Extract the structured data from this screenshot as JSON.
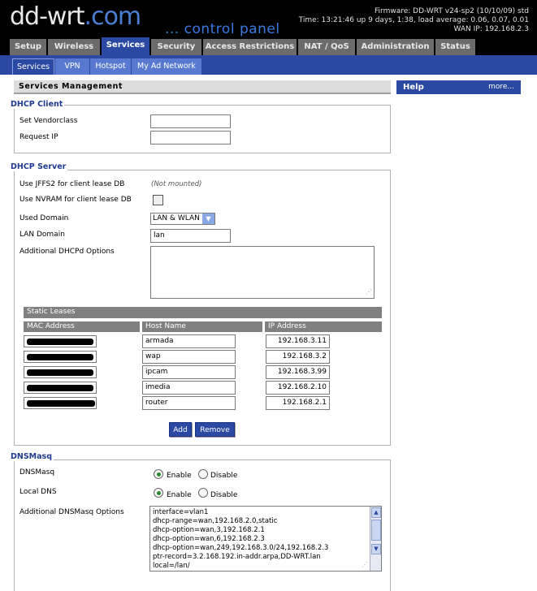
{
  "header": {
    "logo_main": "dd-wrt",
    "logo_suffix": ".com",
    "panel_label": "... control panel",
    "firmware": "Firmware: DD-WRT v24-sp2 (10/10/09) std",
    "time": "Time: 13:21:46 up 9 days, 1:38, load average: 0.06, 0.07, 0.01",
    "wan_ip": "WAN IP: 192.168.2.3"
  },
  "main_tabs": [
    "Setup",
    "Wireless",
    "Services",
    "Security",
    "Access Restrictions",
    "NAT / QoS",
    "Administration",
    "Status"
  ],
  "sub_tabs": [
    "Services",
    "VPN",
    "Hotspot",
    "My Ad Network"
  ],
  "section_title": "Services Management",
  "help": {
    "title": "Help",
    "more": "more..."
  },
  "dhcp_client": {
    "legend": "DHCP Client",
    "vendorclass_label": "Set Vendorclass",
    "vendorclass_value": "",
    "request_ip_label": "Request IP",
    "request_ip_value": ""
  },
  "dhcp_server": {
    "legend": "DHCP Server",
    "jffs2_label": "Use JFFS2 for client lease DB",
    "jffs2_note": "(Not mounted)",
    "nvram_label": "Use NVRAM for client lease DB",
    "used_domain_label": "Used Domain",
    "used_domain_value": "LAN & WLAN",
    "lan_domain_label": "LAN Domain",
    "lan_domain_value": "lan",
    "dhcpd_options_label": "Additional DHCPd Options",
    "dhcpd_options_value": ""
  },
  "static_leases": {
    "title": "Static Leases",
    "columns": [
      "MAC Address",
      "Host Name",
      "IP Address"
    ],
    "rows": [
      {
        "host": "armada",
        "ip": "192.168.3.11"
      },
      {
        "host": "wap",
        "ip": "192.168.3.2"
      },
      {
        "host": "ipcam",
        "ip": "192.168.3.99"
      },
      {
        "host": "imedia",
        "ip": "192.168.2.10"
      },
      {
        "host": "router",
        "ip": "192.168.2.1"
      }
    ],
    "add_label": "Add",
    "remove_label": "Remove"
  },
  "dnsmasq": {
    "legend": "DNSMasq",
    "dnsmasq_label": "DNSMasq",
    "local_dns_label": "Local DNS",
    "enable_label": "Enable",
    "disable_label": "Disable",
    "options_label": "Additional DNSMasq Options",
    "options_lines": [
      "interface=vlan1",
      "dhcp-range=wan,192.168.2.0,static",
      "dhcp-option=wan,3,192.168.2.1",
      "dhcp-option=wan,6,192.168.2.3",
      "dhcp-option=wan,249,192.168.3.0/24,192.168.2.3",
      "ptr-record=3.2.168.192.in-addr.arpa,DD-WRT.lan",
      "local=/lan/"
    ]
  }
}
